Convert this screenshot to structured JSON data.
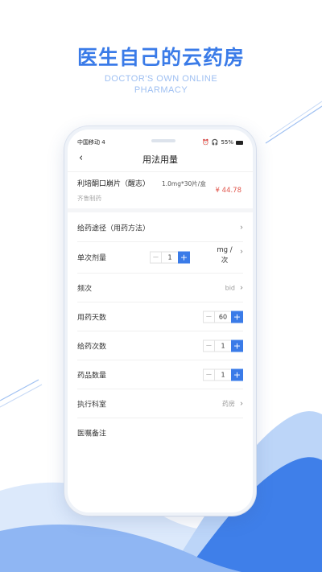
{
  "hero": {
    "title": "医生自己的云药房",
    "subtitle_line1": "DOCTOR'S OWN ONLINE",
    "subtitle_line2": "PHARMACY"
  },
  "colors": {
    "accent": "#3a7be8",
    "price": "#e0564c",
    "wave_light": "#dce9fb",
    "wave_mid": "#8fb6f3",
    "wave_dark": "#3f7fe9"
  },
  "status_bar": {
    "carrier": "中国移动",
    "network": "4",
    "battery": "55%"
  },
  "navbar": {
    "back_icon": "chevron-left-icon",
    "title": "用法用量"
  },
  "product": {
    "name": "利培酮口崩片（醒志）",
    "spec": "1.0mg*30片/盒",
    "manufacturer": "齐鲁制药",
    "price": "¥ 44.78"
  },
  "rows": {
    "route": {
      "label": "给药途径（用药方法）"
    },
    "single_dose": {
      "label": "单次剂量",
      "value": "1",
      "unit_line1": "mg /",
      "unit_line2": "次"
    },
    "frequency": {
      "label": "频次",
      "value": "bid"
    },
    "days": {
      "label": "用药天数",
      "value": "60"
    },
    "times": {
      "label": "给药次数",
      "value": "1"
    },
    "quantity": {
      "label": "药品数量",
      "value": "1"
    },
    "department": {
      "label": "执行科室",
      "value": "药房"
    },
    "notes": {
      "label": "医嘱备注"
    }
  },
  "stepper": {
    "minus": "−",
    "plus": "+"
  },
  "chevron": "›"
}
